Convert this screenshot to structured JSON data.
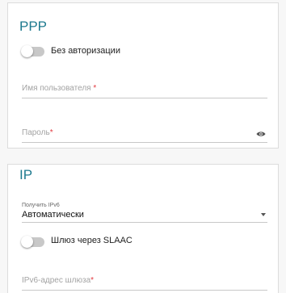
{
  "ppp": {
    "title": "PPP",
    "no_auth_toggle": {
      "label": "Без авторизации",
      "on": false
    },
    "username": {
      "placeholder": "Имя пользователя",
      "required_mark": "*"
    },
    "password": {
      "placeholder": "Пароль",
      "required_mark": "*",
      "icon": "eye-icon"
    }
  },
  "ip": {
    "title": "IP",
    "ipv6_select": {
      "caption": "Получить IPv6",
      "value": "Автоматически",
      "icon": "chevron-down-icon"
    },
    "slaac_toggle": {
      "label": "Шлюз через SLAAC",
      "on": false
    },
    "gateway": {
      "placeholder": "IPv6-адрес шлюза",
      "required_mark": "*"
    }
  },
  "colors": {
    "accent": "#1e7a8f",
    "required": "#e2383f",
    "toggle_off": "#c8c8c8"
  }
}
